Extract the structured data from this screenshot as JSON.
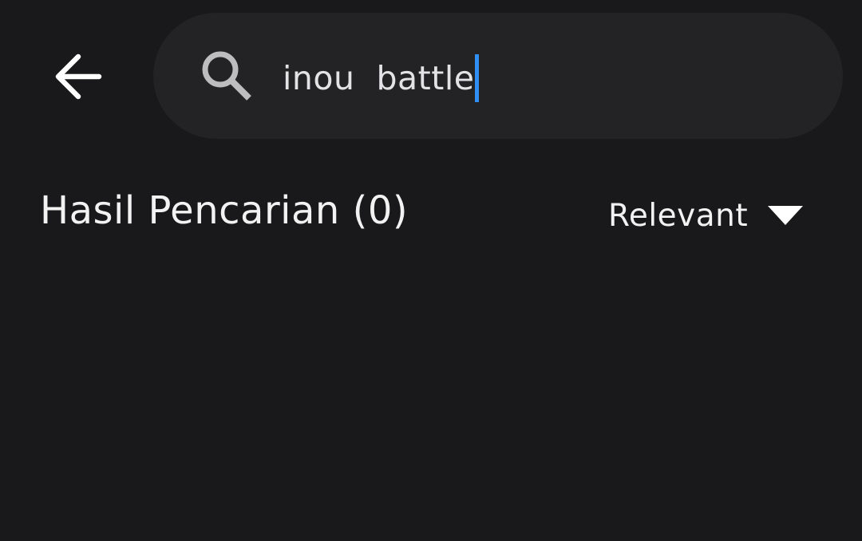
{
  "header": {
    "back_icon": "arrow-left-icon",
    "search": {
      "icon": "search-icon",
      "value": "inou  battle"
    }
  },
  "results": {
    "title": "Hasil Pencarian (0)",
    "sort": {
      "selected": "Relevant",
      "icon": "triangle-down-icon"
    }
  },
  "colors": {
    "background": "#19191b",
    "search_bar": "#232326",
    "caret": "#2f8ff5",
    "text": "#f2f2f2"
  }
}
